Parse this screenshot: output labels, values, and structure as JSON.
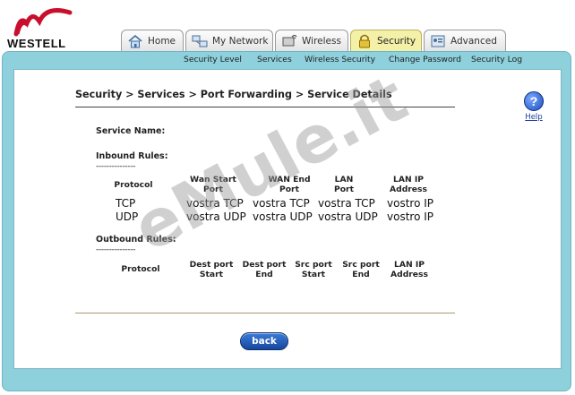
{
  "brand": {
    "name": "WESTELL"
  },
  "tabs": [
    {
      "label": "Home",
      "icon": "home-icon",
      "active": false
    },
    {
      "label": "My Network",
      "icon": "network-icon",
      "active": false
    },
    {
      "label": "Wireless",
      "icon": "wireless-icon",
      "active": false
    },
    {
      "label": "Security",
      "icon": "lock-icon",
      "active": true
    },
    {
      "label": "Advanced",
      "icon": "advanced-icon",
      "active": false
    }
  ],
  "subnav": [
    "Security Level",
    "Services",
    "Wireless Security",
    "Change Password",
    "Security Log"
  ],
  "breadcrumb": "Security > Services > Port Forwarding > Service Details",
  "help": {
    "symbol": "?",
    "label": "Help"
  },
  "service": {
    "name_label": "Service Name:"
  },
  "inbound": {
    "title": "Inbound Rules:",
    "divider": "---------------",
    "headers": [
      "Protocol",
      "Wan Start Port",
      "WAN End Port",
      "LAN Port",
      "LAN IP Address"
    ],
    "rows": [
      [
        "TCP",
        "vostra TCP",
        "vostra TCP",
        "vostra TCP",
        "vostro IP"
      ],
      [
        "UDP",
        "vostra UDP",
        "vostra UDP",
        "vostra UDP",
        "vostro IP"
      ]
    ]
  },
  "outbound": {
    "title": "Outbound Rules:",
    "divider": "---------------",
    "headers": [
      "Protocol",
      "Dest port Start",
      "Dest port End",
      "Src port Start",
      "Src port End",
      "LAN IP Address"
    ]
  },
  "buttons": {
    "back": "back"
  },
  "watermark": "eMule.it",
  "colors": {
    "frame": "#8ed0dc",
    "active_tab": "#f5f0a8",
    "button": "#1f5bc0",
    "brand_red": "#c8102e"
  }
}
